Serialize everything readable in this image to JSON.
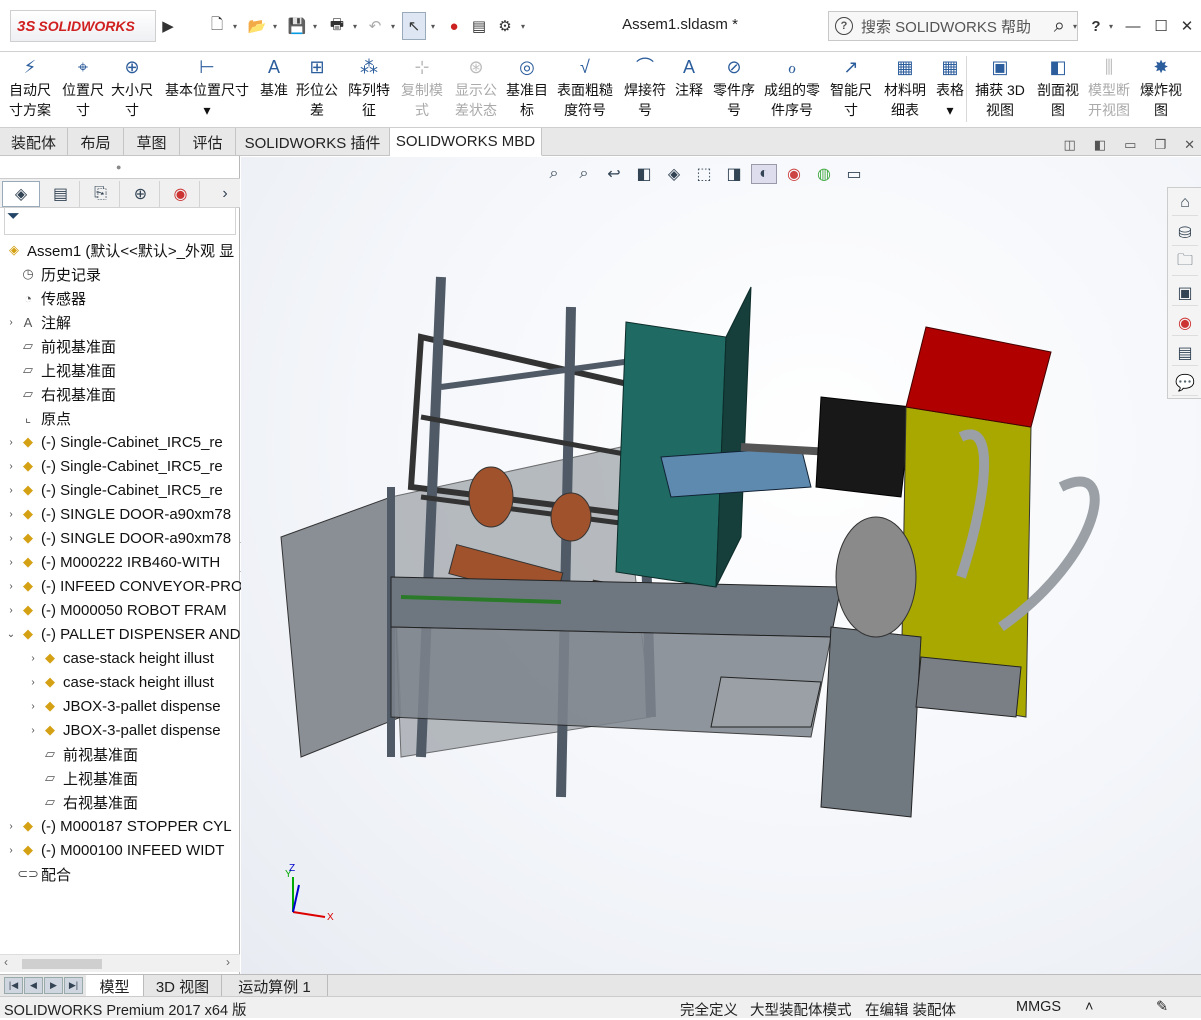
{
  "app": {
    "brand_ds": "3S",
    "brand_name": "SOLIDWORKS",
    "doc_title": "Assem1.sldasm *"
  },
  "search": {
    "placeholder": "搜索 SOLIDWORKS 帮助"
  },
  "titlebar": {
    "help": "?",
    "minimize": "—",
    "maximize": "☐",
    "close": "✕"
  },
  "ribbon": [
    {
      "id": "auto-dim",
      "label1": "自动尺",
      "label2": "寸方案",
      "icon": "auto-dimension-icon",
      "glyph": "⚡",
      "enabled": true
    },
    {
      "id": "loc-dim",
      "label1": "位置尺",
      "label2": "寸",
      "icon": "location-dimension-icon",
      "glyph": "⌖",
      "enabled": true
    },
    {
      "id": "size-dim",
      "label1": "大小尺",
      "label2": "寸",
      "icon": "size-dimension-icon",
      "glyph": "⊕",
      "enabled": true
    },
    {
      "id": "basic-loc-dim",
      "label1": "基本位置尺寸",
      "label2": "▾",
      "icon": "basic-location-dimension-icon",
      "glyph": "⊢",
      "enabled": true
    },
    {
      "id": "datum",
      "label1": "基准",
      "label2": "",
      "icon": "datum-icon",
      "glyph": "A",
      "enabled": true
    },
    {
      "id": "geo-tol",
      "label1": "形位公",
      "label2": "差",
      "icon": "geometric-tolerance-icon",
      "glyph": "⊞",
      "enabled": true
    },
    {
      "id": "pattern-feat",
      "label1": "阵列特",
      "label2": "征",
      "icon": "pattern-feature-icon",
      "glyph": "⁂",
      "enabled": true
    },
    {
      "id": "copy-scheme",
      "label1": "复制模",
      "label2": "式",
      "icon": "copy-scheme-icon",
      "glyph": "⊹",
      "enabled": false
    },
    {
      "id": "show-tol",
      "label1": "显示公",
      "label2": "差状态",
      "icon": "show-tolerance-status-icon",
      "glyph": "⊛",
      "enabled": false
    },
    {
      "id": "datum-target",
      "label1": "基准目",
      "label2": "标",
      "icon": "datum-target-icon",
      "glyph": "◎",
      "enabled": true
    },
    {
      "id": "surface-finish",
      "label1": "表面粗糙",
      "label2": "度符号",
      "icon": "surface-finish-icon",
      "glyph": "√",
      "enabled": true
    },
    {
      "id": "weld",
      "label1": "焊接符",
      "label2": "号",
      "icon": "weld-symbol-icon",
      "glyph": "⌒",
      "enabled": true
    },
    {
      "id": "note",
      "label1": "注释",
      "label2": "",
      "icon": "note-icon",
      "glyph": "A",
      "enabled": true
    },
    {
      "id": "balloon",
      "label1": "零件序",
      "label2": "号",
      "icon": "balloon-icon",
      "glyph": "⊘",
      "enabled": true
    },
    {
      "id": "stacked-balloon",
      "label1": "成组的零",
      "label2": "件序号",
      "icon": "stacked-balloon-icon",
      "glyph": "ℴ",
      "enabled": true
    },
    {
      "id": "smart-dim",
      "label1": "智能尺",
      "label2": "寸",
      "icon": "smart-dimension-icon",
      "glyph": "↗",
      "enabled": true
    },
    {
      "id": "bom",
      "label1": "材料明",
      "label2": "细表",
      "icon": "bill-of-materials-icon",
      "glyph": "▦",
      "enabled": true
    },
    {
      "id": "table",
      "label1": "表格",
      "label2": "▾",
      "icon": "table-icon",
      "glyph": "▦",
      "enabled": true
    },
    {
      "id": "capture-3d",
      "label1": "捕获 3D",
      "label2": "视图",
      "icon": "capture-3d-view-icon",
      "glyph": "▣",
      "enabled": true
    },
    {
      "id": "section-view",
      "label1": "剖面视",
      "label2": "图",
      "icon": "section-view-icon",
      "glyph": "◧",
      "enabled": true
    },
    {
      "id": "model-break",
      "label1": "模型断",
      "label2": "开视图",
      "icon": "model-break-view-icon",
      "glyph": "⫼",
      "enabled": false
    },
    {
      "id": "explode",
      "label1": "爆炸视",
      "label2": "图",
      "icon": "exploded-view-icon",
      "glyph": "✸",
      "enabled": true
    }
  ],
  "tabs": [
    "装配体",
    "布局",
    "草图",
    "评估",
    "SOLIDWORKS 插件",
    "SOLIDWORKS MBD"
  ],
  "active_tab": "SOLIDWORKS MBD",
  "tree": [
    {
      "label": "Assem1  (默认<<默认>_外观 显",
      "level": 0,
      "arrow": "",
      "icon": "assembly-icon",
      "kind": "comp"
    },
    {
      "label": "历史记录",
      "level": 1,
      "arrow": "",
      "icon": "history-icon",
      "kind": "plane"
    },
    {
      "label": "传感器",
      "level": 1,
      "arrow": "",
      "icon": "sensor-icon",
      "kind": "plane"
    },
    {
      "label": "注解",
      "level": 1,
      "arrow": "›",
      "icon": "annotation-icon",
      "kind": "plane"
    },
    {
      "label": "前视基准面",
      "level": 1,
      "arrow": "",
      "icon": "plane-icon",
      "kind": "plane"
    },
    {
      "label": "上视基准面",
      "level": 1,
      "arrow": "",
      "icon": "plane-icon",
      "kind": "plane"
    },
    {
      "label": "右视基准面",
      "level": 1,
      "arrow": "",
      "icon": "plane-icon",
      "kind": "plane"
    },
    {
      "label": "原点",
      "level": 1,
      "arrow": "",
      "icon": "origin-icon",
      "kind": "plane"
    },
    {
      "label": "(-) Single-Cabinet_IRC5_re",
      "level": 1,
      "arrow": "›",
      "icon": "component-icon",
      "kind": "comp"
    },
    {
      "label": "(-) Single-Cabinet_IRC5_re",
      "level": 1,
      "arrow": "›",
      "icon": "component-icon",
      "kind": "comp"
    },
    {
      "label": "(-) Single-Cabinet_IRC5_re",
      "level": 1,
      "arrow": "›",
      "icon": "component-icon",
      "kind": "comp"
    },
    {
      "label": "(-) SINGLE DOOR-a90xm78",
      "level": 1,
      "arrow": "›",
      "icon": "component-icon",
      "kind": "comp"
    },
    {
      "label": "(-) SINGLE DOOR-a90xm78",
      "level": 1,
      "arrow": "›",
      "icon": "component-icon",
      "kind": "comp"
    },
    {
      "label": "(-) M000222 IRB460-WITH",
      "level": 1,
      "arrow": "›",
      "icon": "component-icon",
      "kind": "comp"
    },
    {
      "label": "(-) INFEED CONVEYOR-PRO",
      "level": 1,
      "arrow": "›",
      "icon": "component-icon",
      "kind": "comp"
    },
    {
      "label": "(-) M000050 ROBOT FRAM",
      "level": 1,
      "arrow": "›",
      "icon": "component-icon",
      "kind": "comp"
    },
    {
      "label": "(-) PALLET DISPENSER AND",
      "level": 1,
      "arrow": "⌄",
      "icon": "component-icon",
      "kind": "comp"
    },
    {
      "label": "case-stack height illust",
      "level": 2,
      "arrow": "›",
      "icon": "component-icon",
      "kind": "comp"
    },
    {
      "label": "case-stack height illust",
      "level": 2,
      "arrow": "›",
      "icon": "component-icon",
      "kind": "comp"
    },
    {
      "label": "JBOX-3-pallet dispense",
      "level": 2,
      "arrow": "›",
      "icon": "component-icon",
      "kind": "comp"
    },
    {
      "label": "JBOX-3-pallet dispense",
      "level": 2,
      "arrow": "›",
      "icon": "component-icon",
      "kind": "comp"
    },
    {
      "label": "前视基准面",
      "level": 2,
      "arrow": "",
      "icon": "plane-icon",
      "kind": "plane"
    },
    {
      "label": "上视基准面",
      "level": 2,
      "arrow": "",
      "icon": "plane-icon",
      "kind": "plane"
    },
    {
      "label": "右视基准面",
      "level": 2,
      "arrow": "",
      "icon": "plane-icon",
      "kind": "plane"
    },
    {
      "label": "(-) M000187 STOPPER CYL",
      "level": 1,
      "arrow": "›",
      "icon": "component-icon",
      "kind": "comp"
    },
    {
      "label": "(-) M000100 INFEED WIDT",
      "level": 1,
      "arrow": "›",
      "icon": "component-icon",
      "kind": "comp"
    },
    {
      "label": "配合",
      "level": 1,
      "arrow": "",
      "icon": "mates-icon",
      "kind": "plane"
    }
  ],
  "bottom_tabs": [
    "模型",
    "3D 视图",
    "运动算例 1"
  ],
  "active_bottom_tab": "模型",
  "status": {
    "product": "SOLIDWORKS Premium 2017 x64 版",
    "definition": "完全定义",
    "mode": "大型装配体模式",
    "editing": "在编辑 装配体",
    "units": "MMGS",
    "units_dd": "˄"
  },
  "triad": {
    "x": "X",
    "y": "Y",
    "z": "Z"
  },
  "colors": {
    "accent": "#2c5d9c",
    "brand": "#d02020",
    "cabinet_teal": "#1f6a63",
    "cabinet_yellow": "#a8a800",
    "cabinet_red": "#b00000",
    "frame": "#4f5a66",
    "robot": "#a0522d"
  }
}
